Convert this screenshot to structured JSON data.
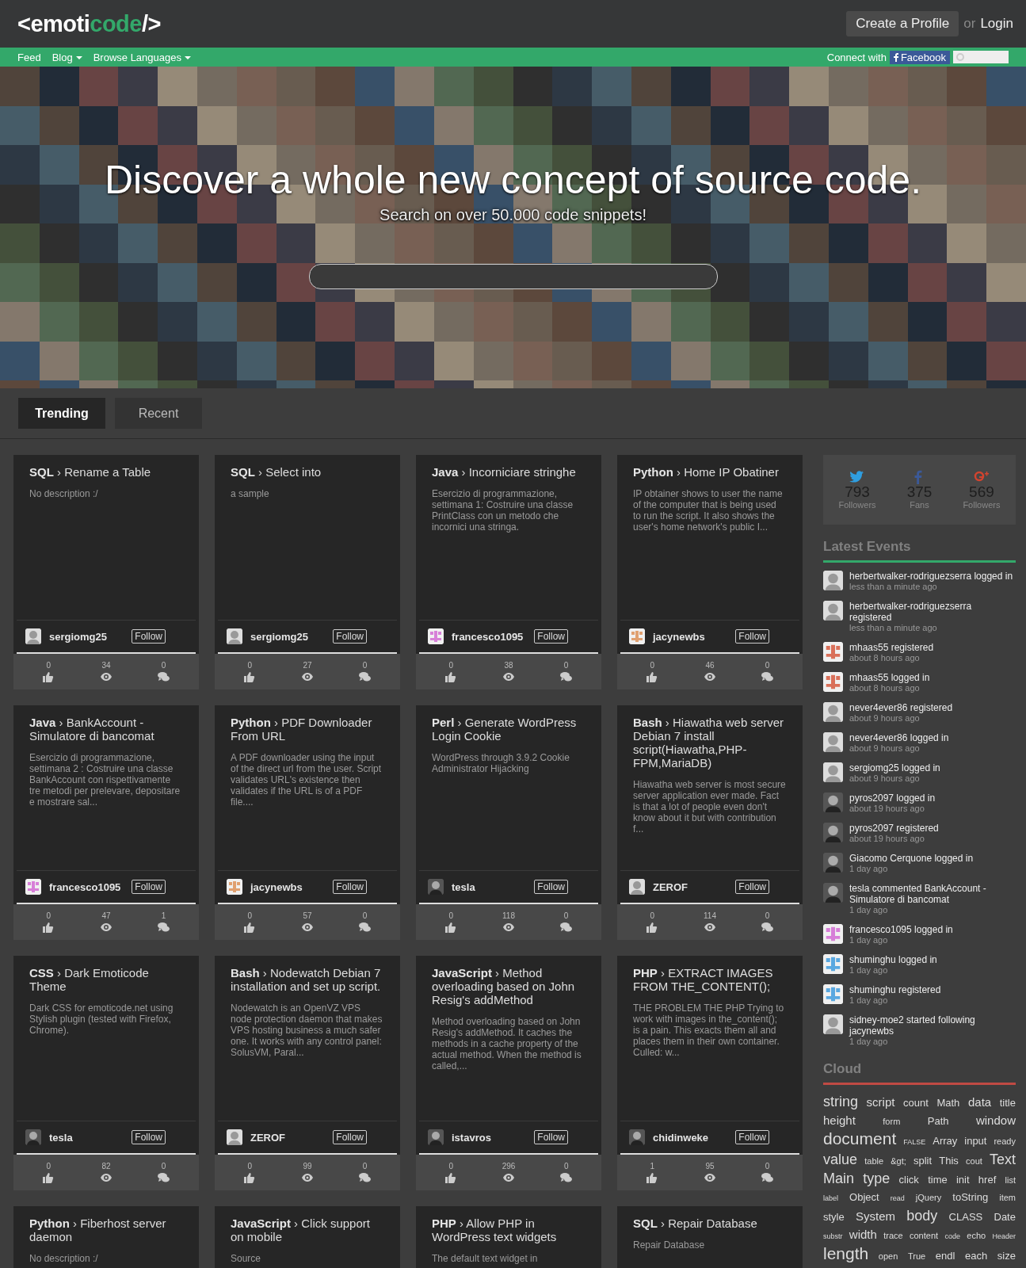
{
  "header": {
    "logo": {
      "start": "<emoti",
      "accent": "code",
      "end": "/>"
    },
    "create_profile": "Create a Profile",
    "or": "or",
    "login": "Login"
  },
  "nav": {
    "items": [
      {
        "label": "Feed",
        "dropdown": false
      },
      {
        "label": "Blog",
        "dropdown": true
      },
      {
        "label": "Browse Languages",
        "dropdown": true
      }
    ],
    "connect_label": "Connect with",
    "facebook": "Facebook"
  },
  "hero": {
    "title": "Discover a whole new concept of source code.",
    "subtitle": "Search on over 50.000 code snippets!"
  },
  "tabs": [
    {
      "label": "Trending",
      "selected": true
    },
    {
      "label": "Recent",
      "selected": false
    }
  ],
  "snippets": [
    {
      "language": "SQL",
      "separator": "›",
      "title": "Rename a Table",
      "description": "No description :/",
      "follow": "Follow",
      "user": "sergiomg25",
      "avatar": {
        "kind": "silhouette"
      },
      "likes": "0",
      "views": "34",
      "comments": "0"
    },
    {
      "language": "SQL",
      "separator": "›",
      "title": "Select into",
      "description": "a sample",
      "follow": "Follow",
      "user": "sergiomg25",
      "avatar": {
        "kind": "silhouette"
      },
      "likes": "0",
      "views": "27",
      "comments": "0"
    },
    {
      "language": "Java",
      "separator": "›",
      "follow": "Follow",
      "title": "Incorniciare stringhe",
      "description": "Esercizio di programmazione, settimana 1: Costruire una classe PrintClass con un metodo che incornici una stringa.",
      "user": "francesco1095",
      "avatar": {
        "kind": "identicon",
        "color": "#d77fd8"
      },
      "likes": "0",
      "views": "38",
      "comments": "0"
    },
    {
      "language": "Python",
      "separator": "›",
      "follow": "Follow",
      "title": "Home IP Obatiner",
      "description": "IP obtainer shows to user the name of the computer that is being used to run the script. It also shows the user's home network's public I...",
      "user": "jacynewbs",
      "avatar": {
        "kind": "identicon",
        "color": "#e0a070"
      },
      "likes": "0",
      "views": "46",
      "comments": "0"
    },
    {
      "language": "Java",
      "separator": "›",
      "follow": "Follow",
      "title": "BankAccount - Simulatore di bancomat",
      "description": "Esercizio di programmazione, settimana 2 : Costruire una classe BankAccount con rispettivamente tre metodi per prelevare, depositare e mostrare sal...",
      "user": "francesco1095",
      "avatar": {
        "kind": "identicon",
        "color": "#d77fd8"
      },
      "likes": "0",
      "views": "47",
      "comments": "1"
    },
    {
      "language": "Python",
      "separator": "›",
      "follow": "Follow",
      "title": "PDF Downloader From URL",
      "description": "A PDF downloader using the input of the direct url from the user. Script validates URL's existence then validates if the URL is of a PDF file....",
      "user": "jacynewbs",
      "avatar": {
        "kind": "identicon",
        "color": "#e0a070"
      },
      "likes": "0",
      "views": "57",
      "comments": "0"
    },
    {
      "language": "Perl",
      "separator": "›",
      "follow": "Follow",
      "title": "Generate WordPress Login Cookie",
      "description": "WordPress through 3.9.2 Cookie Administrator Hijacking",
      "user": "tesla",
      "avatar": {
        "kind": "photo"
      },
      "likes": "0",
      "views": "118",
      "comments": "0"
    },
    {
      "language": "Bash",
      "separator": "›",
      "follow": "Follow",
      "title": "Hiawatha web server Debian 7 install script(Hiawatha,PHP-FPM,MariaDB)",
      "description": "Hiawatha web server is most secure server application ever made. Fact is that a lot of people even don't know about it but with contribution f...",
      "user": "ZEROF",
      "avatar": {
        "kind": "silhouette"
      },
      "likes": "0",
      "views": "114",
      "comments": "0"
    },
    {
      "language": "CSS",
      "separator": "›",
      "follow": "Follow",
      "title": "Dark Emoticode Theme",
      "description": "Dark CSS for emoticode.net using Stylish plugin (tested with Firefox, Chrome).",
      "user": "tesla",
      "avatar": {
        "kind": "photo"
      },
      "likes": "0",
      "views": "82",
      "comments": "0"
    },
    {
      "language": "Bash",
      "separator": "›",
      "follow": "Follow",
      "title": "Nodewatch Debian 7 installation and set up script.",
      "description": "Nodewatch is an OpenVZ VPS node protection daemon that makes VPS hosting business a much safer one. It works with any control panel: SolusVM, Paral...",
      "user": "ZEROF",
      "avatar": {
        "kind": "silhouette"
      },
      "likes": "0",
      "views": "99",
      "comments": "0"
    },
    {
      "language": "JavaScript",
      "separator": "›",
      "follow": "Follow",
      "title": "Method overloading based on John Resig's addMethod",
      "description": "Method overloading based on John Resig's addMethod. It caches the methods in a cache property of the actual method. When the method is called,...",
      "user": "istavros",
      "avatar": {
        "kind": "photo"
      },
      "likes": "0",
      "views": "296",
      "comments": "0"
    },
    {
      "language": "PHP",
      "separator": "›",
      "follow": "Follow",
      "title": "EXTRACT IMAGES FROM THE_CONTENT();",
      "description": "THE PROBLEM THE PHP Trying to work with images in the_content(); is a pain. This exacts them all and places them in their own container. Culled: w...",
      "user": "chidinweke",
      "avatar": {
        "kind": "photo"
      },
      "likes": "1",
      "views": "95",
      "comments": "0"
    },
    {
      "language": "Python",
      "separator": "›",
      "title": "Fiberhost server daemon",
      "description": "No description :/"
    },
    {
      "language": "JavaScript",
      "separator": "›",
      "title": "Click support on mobile",
      "description": "Source"
    },
    {
      "language": "PHP",
      "separator": "›",
      "title": "Allow PHP in WordPress text widgets",
      "description": "The default text widget in"
    },
    {
      "language": "SQL",
      "separator": "›",
      "title": "Repair Database",
      "description": "Repair Database"
    }
  ],
  "social": [
    {
      "kind": "twitter",
      "count": "793",
      "label": "Followers"
    },
    {
      "kind": "facebook",
      "count": "375",
      "label": "Fans"
    },
    {
      "kind": "googleplus",
      "count": "569",
      "label": "Followers"
    }
  ],
  "latest_events": {
    "title": "Latest Events",
    "items": [
      {
        "text": "herbertwalker-rodriguezserra logged in",
        "time": "less than a minute ago",
        "avatar": {
          "kind": "silhouette"
        }
      },
      {
        "text": "herbertwalker-rodriguezserra registered",
        "time": "less than a minute ago",
        "avatar": {
          "kind": "silhouette"
        }
      },
      {
        "text": "mhaas55 registered",
        "time": "about 8 hours ago",
        "avatar": {
          "kind": "identicon",
          "color": "#d9705a"
        }
      },
      {
        "text": "mhaas55 logged in",
        "time": "about 8 hours ago",
        "avatar": {
          "kind": "identicon",
          "color": "#d9705a"
        }
      },
      {
        "text": "never4ever86 registered",
        "time": "about 9 hours ago",
        "avatar": {
          "kind": "silhouette"
        }
      },
      {
        "text": "never4ever86 logged in",
        "time": "about 9 hours ago",
        "avatar": {
          "kind": "silhouette"
        }
      },
      {
        "text": "sergiomg25 logged in",
        "time": "about 9 hours ago",
        "avatar": {
          "kind": "silhouette"
        }
      },
      {
        "text": "pyros2097 logged in",
        "time": "about 19 hours ago",
        "avatar": {
          "kind": "photo"
        }
      },
      {
        "text": "pyros2097 registered",
        "time": "about 19 hours ago",
        "avatar": {
          "kind": "photo"
        }
      },
      {
        "text": "Giacomo Cerquone logged in",
        "time": "1 day ago",
        "avatar": {
          "kind": "photo"
        }
      },
      {
        "text": "tesla commented BankAccount - Simulatore di bancomat",
        "time": "1 day ago",
        "avatar": {
          "kind": "photo"
        }
      },
      {
        "text": "francesco1095 logged in",
        "time": "1 day ago",
        "avatar": {
          "kind": "identicon",
          "color": "#d77fd8"
        }
      },
      {
        "text": "shuminghu logged in",
        "time": "1 day ago",
        "avatar": {
          "kind": "identicon",
          "color": "#5aa8e0"
        }
      },
      {
        "text": "shuminghu registered",
        "time": "1 day ago",
        "avatar": {
          "kind": "identicon",
          "color": "#5aa8e0"
        }
      },
      {
        "text": "sidney-moe2 started following jacynewbs",
        "time": "1 day ago",
        "avatar": {
          "kind": "silhouette"
        }
      }
    ]
  },
  "cloud": {
    "title": "Cloud",
    "tags": [
      {
        "label": "string",
        "kind": "xl"
      },
      {
        "label": "script",
        "kind": "l"
      },
      {
        "label": "count",
        "kind": "m"
      },
      {
        "label": "Math",
        "kind": "m"
      },
      {
        "label": "data",
        "kind": "l"
      },
      {
        "label": "title",
        "kind": "m"
      },
      {
        "label": "height",
        "kind": "l"
      },
      {
        "label": "form",
        "kind": "s"
      },
      {
        "label": "Path",
        "kind": "m"
      },
      {
        "label": "window",
        "kind": "l"
      },
      {
        "label": "document",
        "kind": "xxl"
      },
      {
        "label": "FALSE",
        "kind": "xs"
      },
      {
        "label": "Array",
        "kind": "m"
      },
      {
        "label": "input",
        "kind": "m"
      },
      {
        "label": "ready",
        "kind": "s"
      },
      {
        "label": "value",
        "kind": "xl"
      },
      {
        "label": "table",
        "kind": "s"
      },
      {
        "label": "&gt;",
        "kind": "s"
      },
      {
        "label": "split",
        "kind": "m"
      },
      {
        "label": "This",
        "kind": "m"
      },
      {
        "label": "cout",
        "kind": "s"
      },
      {
        "label": "Text",
        "kind": "xl"
      },
      {
        "label": "Main",
        "kind": "xl"
      },
      {
        "label": "type",
        "kind": "xl"
      },
      {
        "label": "click",
        "kind": "m"
      },
      {
        "label": "time",
        "kind": "m"
      },
      {
        "label": "init",
        "kind": "m"
      },
      {
        "label": "href",
        "kind": "m"
      },
      {
        "label": "list",
        "kind": "s"
      },
      {
        "label": "label",
        "kind": "xs"
      },
      {
        "label": "Object",
        "kind": "m"
      },
      {
        "label": "read",
        "kind": "xs"
      },
      {
        "label": "jQuery",
        "kind": "s"
      },
      {
        "label": "toString",
        "kind": "m"
      },
      {
        "label": "item",
        "kind": "s"
      },
      {
        "label": "style",
        "kind": "m"
      },
      {
        "label": "System",
        "kind": "l"
      },
      {
        "label": "body",
        "kind": "xl"
      },
      {
        "label": "CLASS",
        "kind": "m"
      },
      {
        "label": "Date",
        "kind": "m"
      },
      {
        "label": "substr",
        "kind": "xs"
      },
      {
        "label": "width",
        "kind": "l"
      },
      {
        "label": "trace",
        "kind": "s"
      },
      {
        "label": "content",
        "kind": "s"
      },
      {
        "label": "code",
        "kind": "xs"
      },
      {
        "label": "echo",
        "kind": "s"
      },
      {
        "label": "Header",
        "kind": "xs"
      },
      {
        "label": "length",
        "kind": "xxl"
      },
      {
        "label": "open",
        "kind": "s"
      },
      {
        "label": "True",
        "kind": "s"
      },
      {
        "label": "endl",
        "kind": "m"
      },
      {
        "label": "each",
        "kind": "m"
      },
      {
        "label": "size",
        "kind": "m"
      }
    ]
  }
}
